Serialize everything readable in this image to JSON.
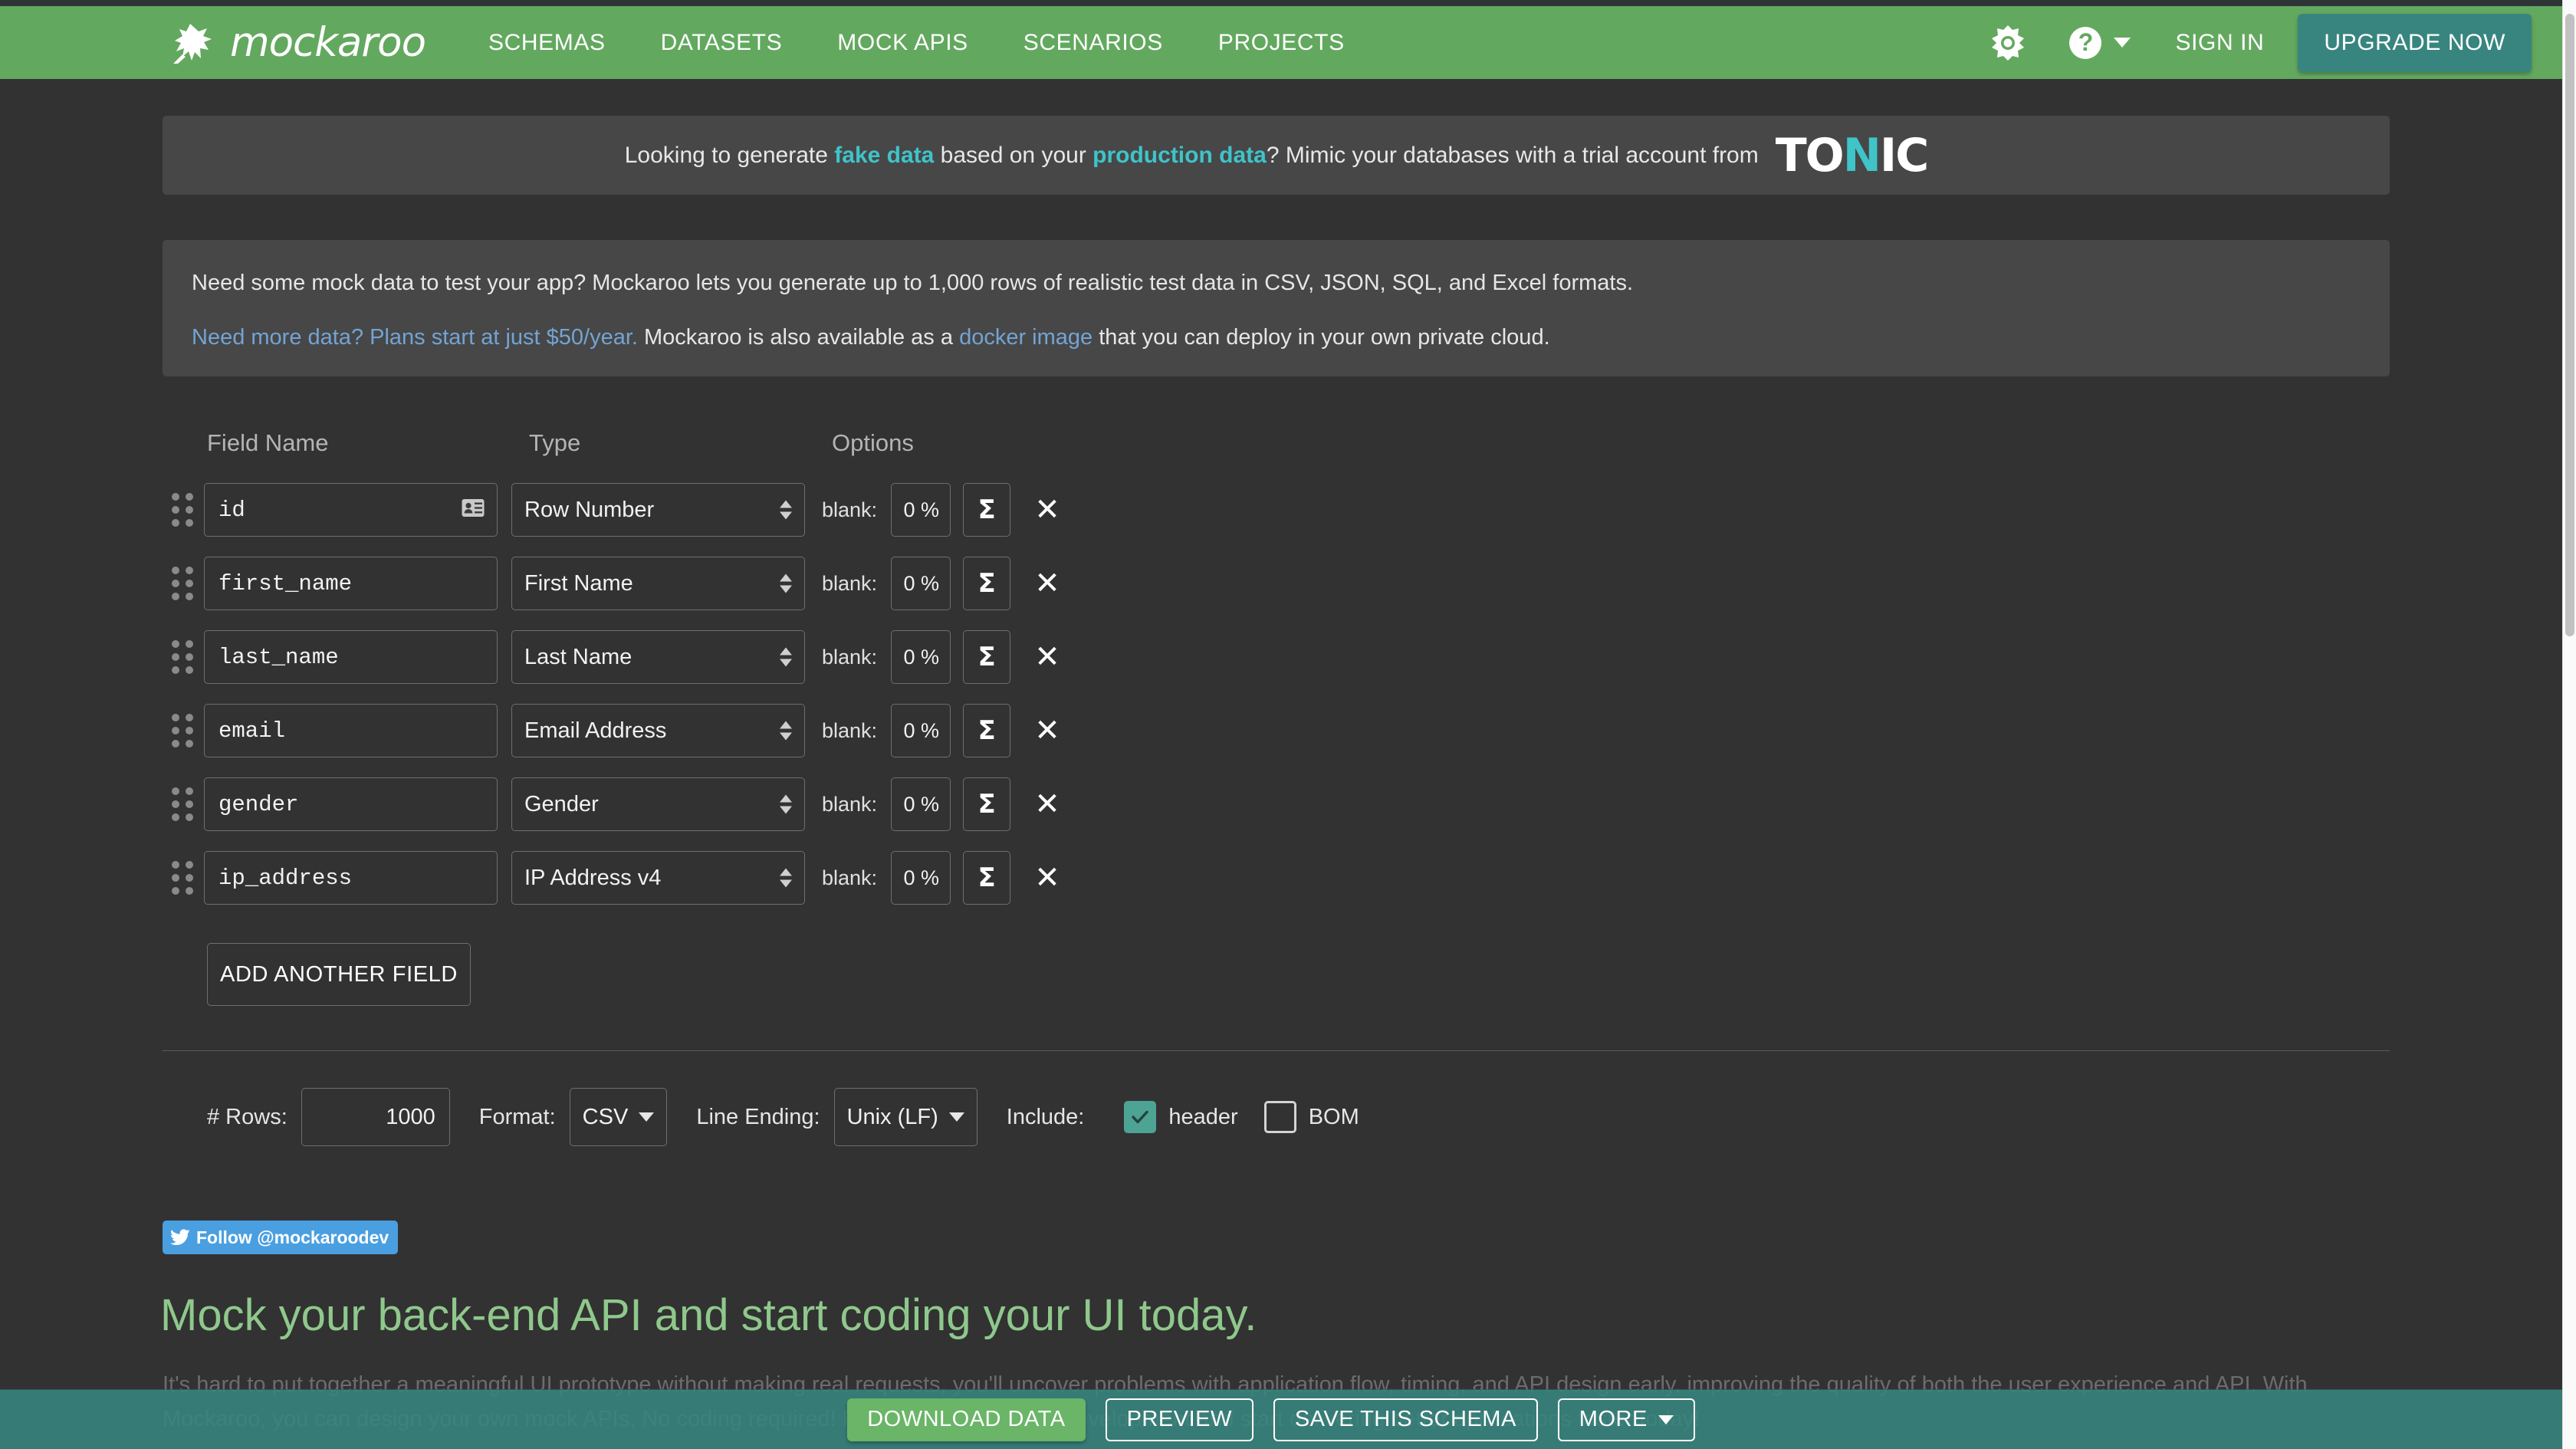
{
  "nav": {
    "brand": "mockaroo",
    "brand_icon": "kangaroo-logo-icon",
    "links": [
      "SCHEMAS",
      "DATASETS",
      "MOCK APIS",
      "SCENARIOS",
      "PROJECTS"
    ],
    "gear_icon": "gear-icon",
    "help_icon": "help-icon",
    "help_glyph": "?",
    "sign_in": "SIGN IN",
    "upgrade": "UPGRADE NOW"
  },
  "tonic_banner": {
    "text_1": "Looking to generate ",
    "link_1": "fake data",
    "text_2": " based on your ",
    "link_2": "production data",
    "text_3": "? Mimic your databases with a trial account from",
    "logo_a": "TO",
    "logo_n": "N",
    "logo_b": "IC"
  },
  "info": {
    "line1": "Need some mock data to test your app? Mockaroo lets you generate up to 1,000 rows of realistic test data in CSV, JSON, SQL, and Excel formats.",
    "line2_link1": "Need more data? Plans start at just $50/year.",
    "line2_mid": " Mockaroo is also available as a ",
    "line2_link2": "docker image",
    "line2_end": " that you can deploy in your own private cloud."
  },
  "schema": {
    "headers": {
      "field_name": "Field Name",
      "type": "Type",
      "options": "Options"
    },
    "blank_label": "blank:",
    "sigma_glyph": "Σ",
    "delete_glyph": "✕",
    "rows": [
      {
        "name": "id",
        "type": "Row Number",
        "blank": "0 %",
        "has_badge": true
      },
      {
        "name": "first_name",
        "type": "First Name",
        "blank": "0 %",
        "has_badge": false
      },
      {
        "name": "last_name",
        "type": "Last Name",
        "blank": "0 %",
        "has_badge": false
      },
      {
        "name": "email",
        "type": "Email Address",
        "blank": "0 %",
        "has_badge": false
      },
      {
        "name": "gender",
        "type": "Gender",
        "blank": "0 %",
        "has_badge": false
      },
      {
        "name": "ip_address",
        "type": "IP Address v4",
        "blank": "0 %",
        "has_badge": false
      }
    ],
    "add_field": "ADD ANOTHER FIELD"
  },
  "options": {
    "rows_label": "# Rows:",
    "rows_value": "1000",
    "format_label": "Format:",
    "format_value": "CSV",
    "line_ending_label": "Line Ending:",
    "line_ending_value": "Unix (LF)",
    "include_label": "Include:",
    "header_label": "header",
    "header_checked": true,
    "bom_label": "BOM",
    "bom_checked": false
  },
  "twitter": {
    "icon": "twitter-bird-icon",
    "label": "Follow @mockaroodev"
  },
  "marketing": {
    "title": "Mock your back-end API and start coding your UI today.",
    "body": "It's hard to put together a meaningful UI prototype without making real requests, you'll uncover problems with application flow, timing, and API design early, improving the quality of both the user experience and API. With Mockaroo, you can design your own mock APIs, No coding required! Parallelize UI and API development and start delivering better applications faster today!"
  },
  "bottom_bar": {
    "download": "DOWNLOAD DATA",
    "preview": "PREVIEW",
    "save": "SAVE THIS SCHEMA",
    "more": "MORE"
  },
  "colors": {
    "nav_green": "#63a85f",
    "accent_teal": "#38857f",
    "page_bg": "#323232",
    "panel_bg": "#474747",
    "link_blue": "#73a4d4",
    "tonic_cyan": "#3ec4c9",
    "download_green": "#6ab567",
    "heading_green": "#8fc88c",
    "twitter_blue": "#4a9fe0"
  }
}
